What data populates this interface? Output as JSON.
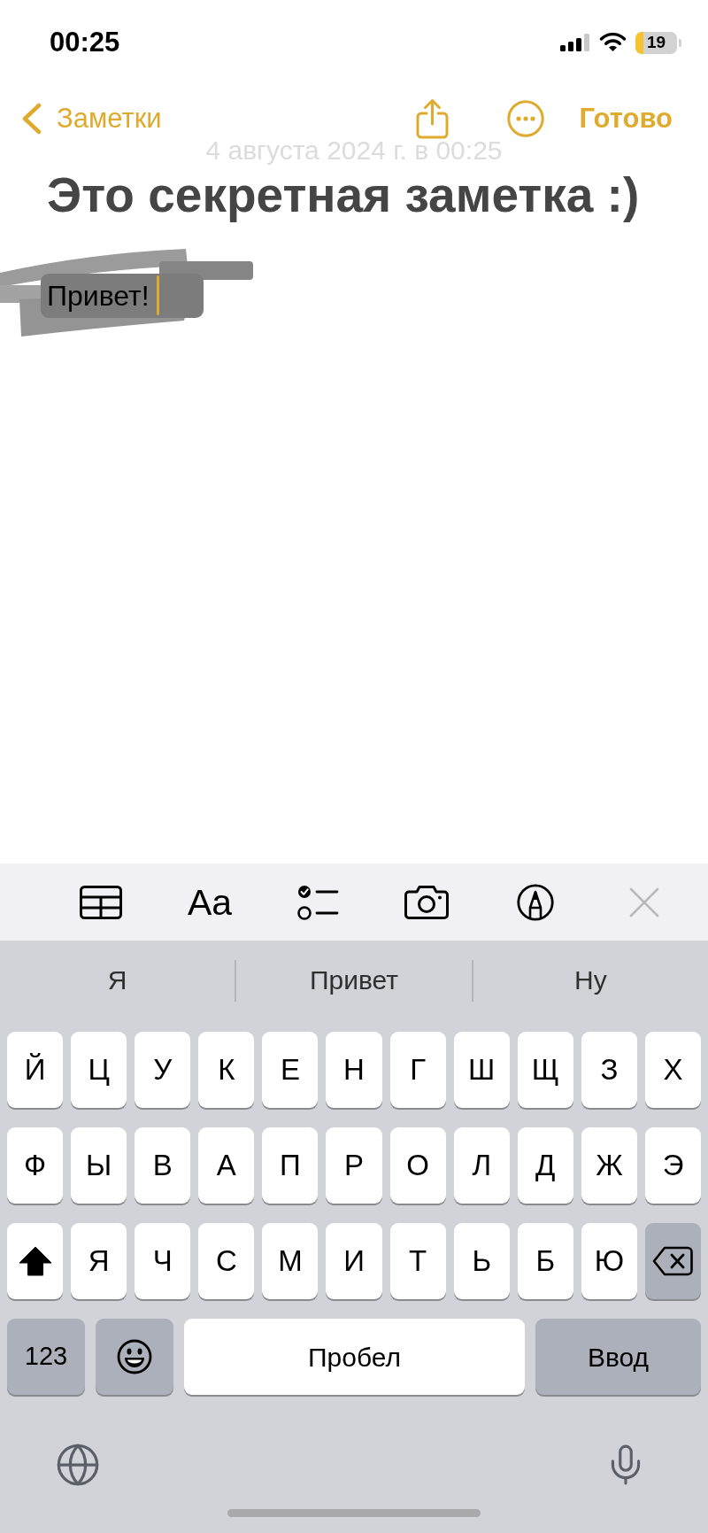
{
  "status_bar": {
    "time": "00:25",
    "battery": "19"
  },
  "nav_bar": {
    "back": "Заметки",
    "done": "Готово"
  },
  "note": {
    "date": "4 августа 2024 г. в 00:25",
    "title": "Это секретная заметка :)",
    "body": "Привет!"
  },
  "format_toolbar": {
    "format_label": "Aa"
  },
  "suggestions": [
    {
      "text": "Я"
    },
    {
      "text": "Привет"
    },
    {
      "text": "Ну"
    }
  ],
  "keyboard": {
    "rows": [
      [
        {
          "kind": "letter",
          "label": "Й"
        },
        {
          "kind": "letter",
          "label": "Ц"
        },
        {
          "kind": "letter",
          "label": "У"
        },
        {
          "kind": "letter",
          "label": "К"
        },
        {
          "kind": "letter",
          "label": "Е"
        },
        {
          "kind": "letter",
          "label": "Н"
        },
        {
          "kind": "letter",
          "label": "Г"
        },
        {
          "kind": "letter",
          "label": "Ш"
        },
        {
          "kind": "letter",
          "label": "Щ"
        },
        {
          "kind": "letter",
          "label": "З"
        },
        {
          "kind": "letter",
          "label": "Х"
        }
      ],
      [
        {
          "kind": "letter",
          "label": "Ф"
        },
        {
          "kind": "letter",
          "label": "Ы"
        },
        {
          "kind": "letter",
          "label": "В"
        },
        {
          "kind": "letter",
          "label": "А"
        },
        {
          "kind": "letter",
          "label": "П"
        },
        {
          "kind": "letter",
          "label": "Р"
        },
        {
          "kind": "letter",
          "label": "О"
        },
        {
          "kind": "letter",
          "label": "Л"
        },
        {
          "kind": "letter",
          "label": "Д"
        },
        {
          "kind": "letter",
          "label": "Ж"
        },
        {
          "kind": "letter",
          "label": "Э"
        }
      ],
      [
        {
          "kind": "shift",
          "on": true
        },
        {
          "kind": "letter",
          "label": "Я"
        },
        {
          "kind": "letter",
          "label": "Ч"
        },
        {
          "kind": "letter",
          "label": "С"
        },
        {
          "kind": "letter",
          "label": "М"
        },
        {
          "kind": "letter",
          "label": "И"
        },
        {
          "kind": "letter",
          "label": "Т"
        },
        {
          "kind": "letter",
          "label": "Ь"
        },
        {
          "kind": "letter",
          "label": "Б"
        },
        {
          "kind": "letter",
          "label": "Ю"
        },
        {
          "kind": "delete"
        }
      ]
    ],
    "bottom_row": [
      {
        "kind": "numbers",
        "label": "123"
      },
      {
        "kind": "emoji"
      },
      {
        "kind": "space",
        "label": "Пробел"
      },
      {
        "kind": "return",
        "label": "Ввод"
      }
    ]
  }
}
